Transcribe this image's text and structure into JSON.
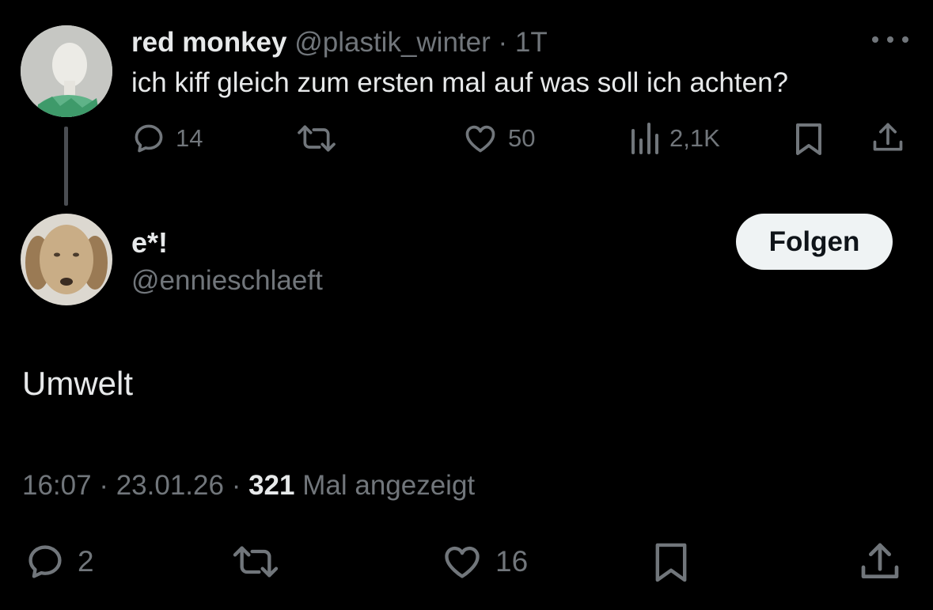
{
  "parent_tweet": {
    "display_name": "red monkey",
    "handle": "@plastik_winter",
    "separator": "·",
    "age": "1T",
    "text": "ich kiff gleich zum ersten mal auf was soll ich achten?",
    "replies": "14",
    "retweets": "",
    "likes": "50",
    "views": "2,1K",
    "avatar_icon": "mannequin-avatar"
  },
  "reply_tweet": {
    "display_name": "e*!",
    "handle": "@ennieschlaeft",
    "follow_label": "Folgen",
    "text": "Umwelt",
    "time": "16:07",
    "date": "23.01.26",
    "separator": "·",
    "views_count": "321",
    "views_label": "Mal angezeigt",
    "replies": "2",
    "retweets": "",
    "likes": "16",
    "avatar_icon": "dog-avatar"
  },
  "colors": {
    "background": "#000000",
    "text_primary": "#e7e9ea",
    "text_secondary": "#71767b",
    "follow_bg": "#eff3f4",
    "follow_text": "#0f1419"
  }
}
